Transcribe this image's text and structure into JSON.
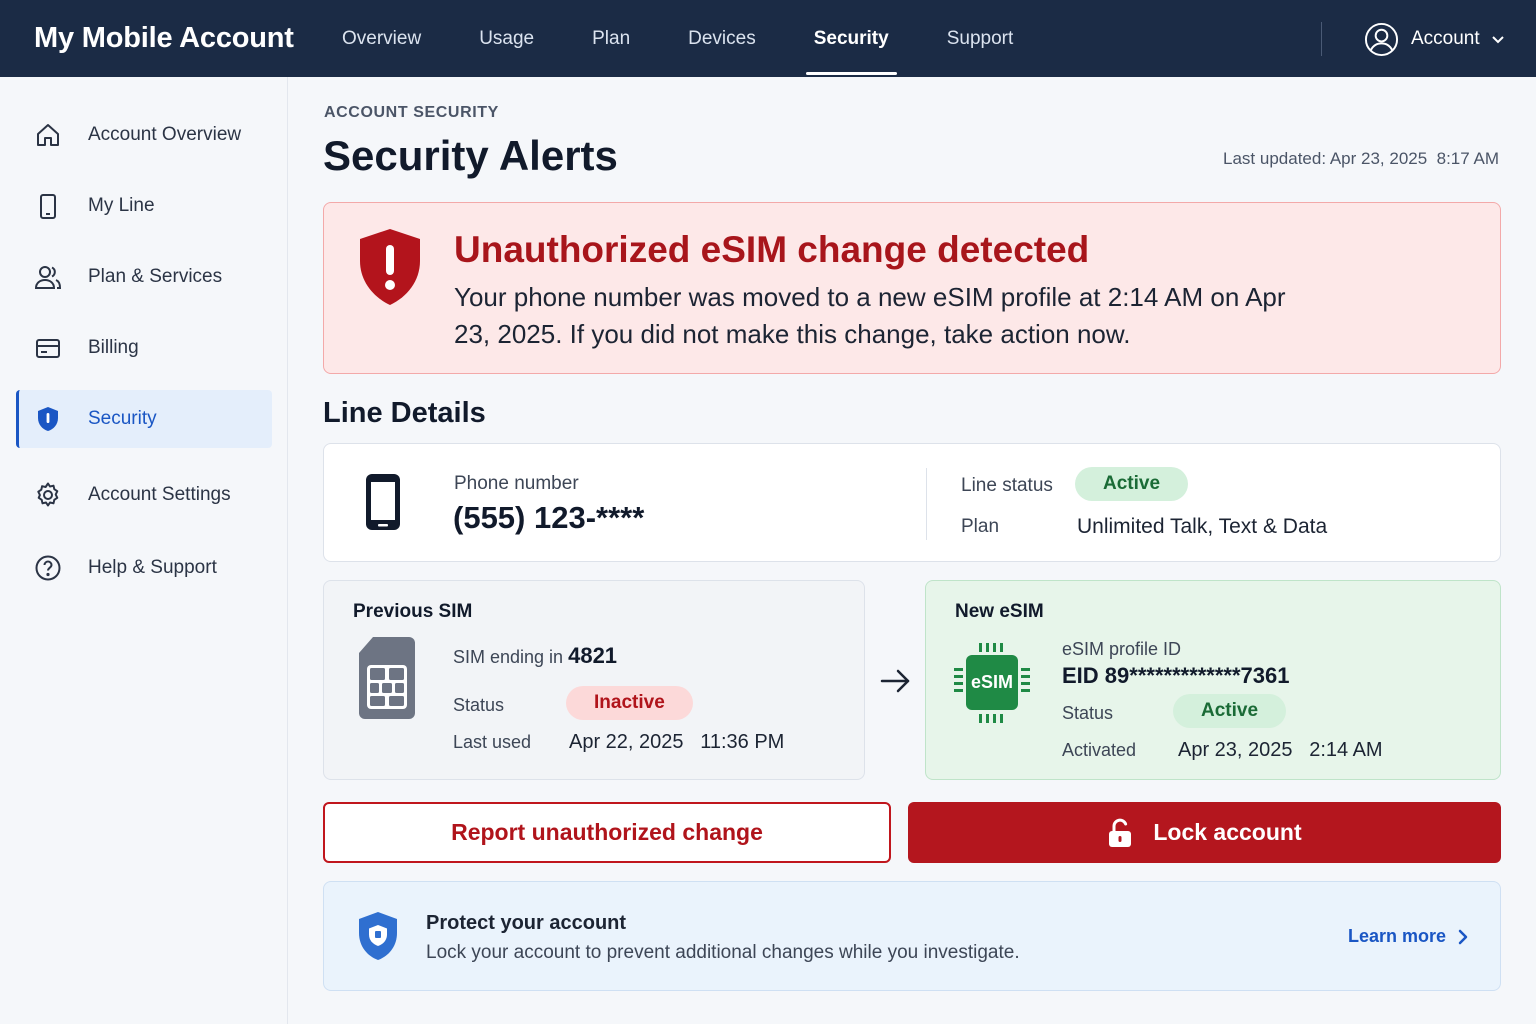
{
  "app": {
    "title": "My Mobile Account"
  },
  "nav": {
    "items": [
      {
        "label": "Overview"
      },
      {
        "label": "Usage"
      },
      {
        "label": "Plan"
      },
      {
        "label": "Devices"
      },
      {
        "label": "Security",
        "active": true
      },
      {
        "label": "Support"
      }
    ],
    "account_label": "Account",
    "account_icon": "user-circle-icon"
  },
  "sidebar": {
    "items": [
      {
        "label": "Account Overview",
        "icon": "home-icon"
      },
      {
        "label": "My Line",
        "icon": "smartphone-icon"
      },
      {
        "label": "Plan & Services",
        "icon": "users-icon"
      },
      {
        "label": "Billing",
        "icon": "credit-card-icon"
      },
      {
        "label": "Security",
        "icon": "shield-icon",
        "active": true
      },
      {
        "label": "Account Settings",
        "icon": "gear-icon"
      },
      {
        "label": "Help & Support",
        "icon": "help-circle-icon"
      }
    ]
  },
  "page": {
    "breadcrumb": "ACCOUNT SECURITY",
    "title": "Security Alerts",
    "last_updated": "Last updated: Apr 23, 2025  8:17 AM"
  },
  "alert": {
    "title": "Unauthorized eSIM change detected",
    "body": "Your phone number was moved to a new eSIM profile at 2:14 AM on Apr 23, 2025. If you did not make this change, take action now.",
    "icon": "shield-alert-icon",
    "color": "#a8151b"
  },
  "line_details": {
    "section_title": "Line Details",
    "phone_label": "Phone number",
    "phone_value": "(555) 123-****",
    "status_label": "Line status",
    "status_value": "Active",
    "plan_label": "Plan",
    "plan_value": "Unlimited Talk, Text & Data"
  },
  "previous_sim": {
    "title": "Previous SIM",
    "ending_label": "SIM ending in",
    "ending_value": "4821",
    "status_label": "Status",
    "status_value": "Inactive",
    "last_used_label": "Last used",
    "last_used_value": "Apr 22, 2025   11:36 PM"
  },
  "new_esim": {
    "title": "New eSIM",
    "chip_label": "eSIM",
    "profile_label": "eSIM profile ID",
    "profile_value": "EID 89*************7361",
    "status_label": "Status",
    "status_value": "Active",
    "activated_label": "Activated",
    "activated_value": "Apr 23, 2025   2:14 AM"
  },
  "actions": {
    "report_label": "Report unauthorized change",
    "lock_label": "Lock account",
    "primary_color": "#b4161e"
  },
  "protect": {
    "title": "Protect your account",
    "body": "Lock your account to prevent additional changes while you investigate.",
    "link_label": "Learn more"
  }
}
